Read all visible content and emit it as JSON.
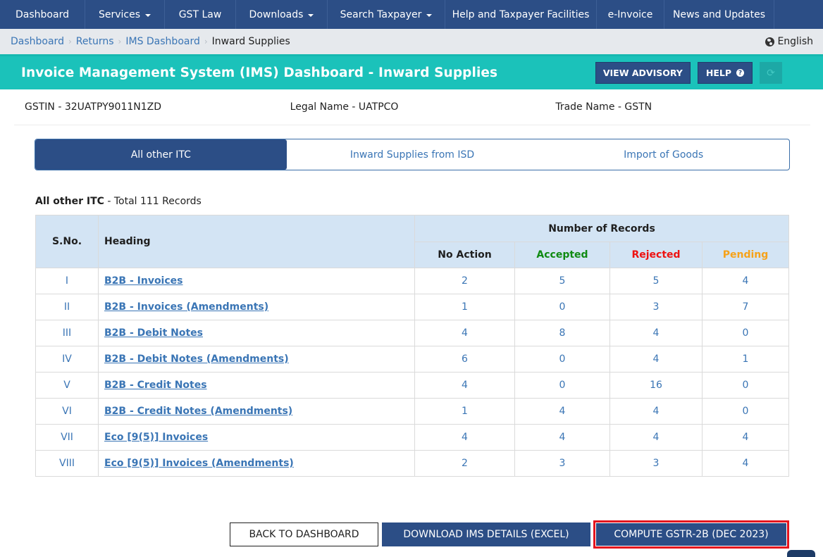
{
  "nav": {
    "items": [
      {
        "label": "Dashboard",
        "dropdown": false
      },
      {
        "label": "Services",
        "dropdown": true
      },
      {
        "label": "GST Law",
        "dropdown": false
      },
      {
        "label": "Downloads",
        "dropdown": true
      },
      {
        "label": "Search Taxpayer",
        "dropdown": true
      },
      {
        "label": "Help and Taxpayer Facilities",
        "dropdown": false
      },
      {
        "label": "e-Invoice",
        "dropdown": false
      },
      {
        "label": "News and Updates",
        "dropdown": false
      }
    ]
  },
  "breadcrumb": {
    "items": [
      "Dashboard",
      "Returns",
      "IMS Dashboard"
    ],
    "current": "Inward Supplies"
  },
  "language": {
    "icon": "globe-icon",
    "label": "English"
  },
  "header": {
    "title": "Invoice Management System (IMS) Dashboard - Inward Supplies",
    "view_advisory_label": "VIEW ADVISORY",
    "help_label": "HELP",
    "help_icon": "question-circle-icon",
    "refresh_icon": "refresh-icon"
  },
  "taxpayer": {
    "gstin": "GSTIN - 32UATPY9011N1ZD",
    "legal_name": "Legal Name - UATPCO",
    "trade_name": "Trade Name - GSTN"
  },
  "tabs": [
    {
      "label": "All other ITC",
      "active": true
    },
    {
      "label": "Inward Supplies from ISD",
      "active": false
    },
    {
      "label": "Import of Goods",
      "active": false
    }
  ],
  "records": {
    "section_title": "All other ITC",
    "total_text": " - Total 111 Records",
    "columns": {
      "sno": "S.No.",
      "heading": "Heading",
      "group": "Number of Records",
      "no_action": "No Action",
      "accepted": "Accepted",
      "rejected": "Rejected",
      "pending": "Pending"
    },
    "status_colors": {
      "accepted": "#0f8a11",
      "rejected": "#ee1111",
      "pending": "#f6a21a"
    },
    "rows": [
      {
        "sno": "I",
        "heading": "B2B - Invoices",
        "no_action": "2",
        "accepted": "5",
        "rejected": "5",
        "pending": "4"
      },
      {
        "sno": "II",
        "heading": "B2B - Invoices (Amendments)",
        "no_action": "1",
        "accepted": "0",
        "rejected": "3",
        "pending": "7"
      },
      {
        "sno": "III",
        "heading": "B2B - Debit Notes",
        "no_action": "4",
        "accepted": "8",
        "rejected": "4",
        "pending": "0"
      },
      {
        "sno": "IV",
        "heading": "B2B - Debit Notes (Amendments)",
        "no_action": "6",
        "accepted": "0",
        "rejected": "4",
        "pending": "1"
      },
      {
        "sno": "V",
        "heading": "B2B - Credit Notes",
        "no_action": "4",
        "accepted": "0",
        "rejected": "16",
        "pending": "0"
      },
      {
        "sno": "VI",
        "heading": "B2B - Credit Notes (Amendments)",
        "no_action": "1",
        "accepted": "4",
        "rejected": "4",
        "pending": "0"
      },
      {
        "sno": "VII",
        "heading": "Eco [9(5)] Invoices",
        "no_action": "4",
        "accepted": "4",
        "rejected": "4",
        "pending": "4"
      },
      {
        "sno": "VIII",
        "heading": "Eco [9(5)] Invoices (Amendments)",
        "no_action": "2",
        "accepted": "3",
        "rejected": "3",
        "pending": "4"
      }
    ]
  },
  "footer": {
    "back_label": "BACK TO DASHBOARD",
    "download_label": "DOWNLOAD IMS DETAILS (EXCEL)",
    "compute_label": "COMPUTE GSTR-2B (DEC 2023)"
  },
  "colors": {
    "nav_bg": "#2c4e86",
    "title_band": "#1bc2ba",
    "link": "#3a75b5",
    "highlight_border": "#e5141e"
  }
}
